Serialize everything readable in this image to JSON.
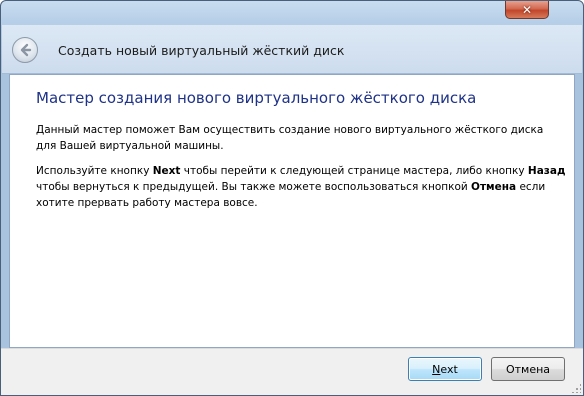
{
  "window": {
    "close_symbol": "✕"
  },
  "header": {
    "title": "Создать новый виртуальный жёсткий диск",
    "back_icon": "back-arrow-icon"
  },
  "content": {
    "main_title": "Мастер создания нового виртуального жёсткого диска",
    "paragraph1": "Данный мастер поможет Вам осуществить создание нового виртуального жёсткого диска для Вашей виртуальной машины.",
    "paragraph2": {
      "part1": "Используйте кнопку ",
      "next_word": "Next",
      "part2": " чтобы перейти к следующей странице мастера, либо кнопку ",
      "back_word": "Назад",
      "part3": " чтобы вернуться к предыдущей. Вы также можете воспользоваться кнопкой ",
      "cancel_word": "Отмена",
      "part4": " если хотите прервать работу мастера вовсе."
    }
  },
  "buttons": {
    "next_label": "Next",
    "cancel_label": "Отмена"
  },
  "colors": {
    "title_blue": "#1e3287",
    "close_red": "#c2452a",
    "frame_blue": "#a9c3de"
  }
}
